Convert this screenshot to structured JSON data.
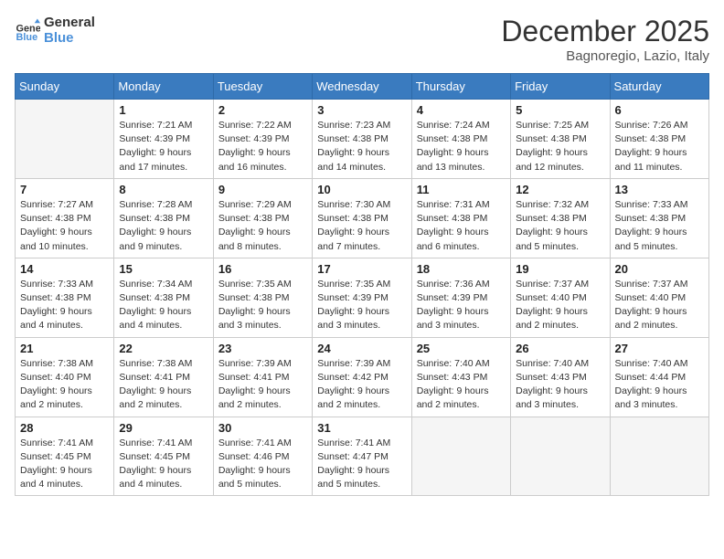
{
  "header": {
    "logo_line1": "General",
    "logo_line2": "Blue",
    "month_title": "December 2025",
    "location": "Bagnoregio, Lazio, Italy"
  },
  "days_of_week": [
    "Sunday",
    "Monday",
    "Tuesday",
    "Wednesday",
    "Thursday",
    "Friday",
    "Saturday"
  ],
  "weeks": [
    [
      {
        "day": "",
        "info": ""
      },
      {
        "day": "1",
        "info": "Sunrise: 7:21 AM\nSunset: 4:39 PM\nDaylight: 9 hours\nand 17 minutes."
      },
      {
        "day": "2",
        "info": "Sunrise: 7:22 AM\nSunset: 4:39 PM\nDaylight: 9 hours\nand 16 minutes."
      },
      {
        "day": "3",
        "info": "Sunrise: 7:23 AM\nSunset: 4:38 PM\nDaylight: 9 hours\nand 14 minutes."
      },
      {
        "day": "4",
        "info": "Sunrise: 7:24 AM\nSunset: 4:38 PM\nDaylight: 9 hours\nand 13 minutes."
      },
      {
        "day": "5",
        "info": "Sunrise: 7:25 AM\nSunset: 4:38 PM\nDaylight: 9 hours\nand 12 minutes."
      },
      {
        "day": "6",
        "info": "Sunrise: 7:26 AM\nSunset: 4:38 PM\nDaylight: 9 hours\nand 11 minutes."
      }
    ],
    [
      {
        "day": "7",
        "info": "Sunrise: 7:27 AM\nSunset: 4:38 PM\nDaylight: 9 hours\nand 10 minutes."
      },
      {
        "day": "8",
        "info": "Sunrise: 7:28 AM\nSunset: 4:38 PM\nDaylight: 9 hours\nand 9 minutes."
      },
      {
        "day": "9",
        "info": "Sunrise: 7:29 AM\nSunset: 4:38 PM\nDaylight: 9 hours\nand 8 minutes."
      },
      {
        "day": "10",
        "info": "Sunrise: 7:30 AM\nSunset: 4:38 PM\nDaylight: 9 hours\nand 7 minutes."
      },
      {
        "day": "11",
        "info": "Sunrise: 7:31 AM\nSunset: 4:38 PM\nDaylight: 9 hours\nand 6 minutes."
      },
      {
        "day": "12",
        "info": "Sunrise: 7:32 AM\nSunset: 4:38 PM\nDaylight: 9 hours\nand 5 minutes."
      },
      {
        "day": "13",
        "info": "Sunrise: 7:33 AM\nSunset: 4:38 PM\nDaylight: 9 hours\nand 5 minutes."
      }
    ],
    [
      {
        "day": "14",
        "info": "Sunrise: 7:33 AM\nSunset: 4:38 PM\nDaylight: 9 hours\nand 4 minutes."
      },
      {
        "day": "15",
        "info": "Sunrise: 7:34 AM\nSunset: 4:38 PM\nDaylight: 9 hours\nand 4 minutes."
      },
      {
        "day": "16",
        "info": "Sunrise: 7:35 AM\nSunset: 4:38 PM\nDaylight: 9 hours\nand 3 minutes."
      },
      {
        "day": "17",
        "info": "Sunrise: 7:35 AM\nSunset: 4:39 PM\nDaylight: 9 hours\nand 3 minutes."
      },
      {
        "day": "18",
        "info": "Sunrise: 7:36 AM\nSunset: 4:39 PM\nDaylight: 9 hours\nand 3 minutes."
      },
      {
        "day": "19",
        "info": "Sunrise: 7:37 AM\nSunset: 4:40 PM\nDaylight: 9 hours\nand 2 minutes."
      },
      {
        "day": "20",
        "info": "Sunrise: 7:37 AM\nSunset: 4:40 PM\nDaylight: 9 hours\nand 2 minutes."
      }
    ],
    [
      {
        "day": "21",
        "info": "Sunrise: 7:38 AM\nSunset: 4:40 PM\nDaylight: 9 hours\nand 2 minutes."
      },
      {
        "day": "22",
        "info": "Sunrise: 7:38 AM\nSunset: 4:41 PM\nDaylight: 9 hours\nand 2 minutes."
      },
      {
        "day": "23",
        "info": "Sunrise: 7:39 AM\nSunset: 4:41 PM\nDaylight: 9 hours\nand 2 minutes."
      },
      {
        "day": "24",
        "info": "Sunrise: 7:39 AM\nSunset: 4:42 PM\nDaylight: 9 hours\nand 2 minutes."
      },
      {
        "day": "25",
        "info": "Sunrise: 7:40 AM\nSunset: 4:43 PM\nDaylight: 9 hours\nand 2 minutes."
      },
      {
        "day": "26",
        "info": "Sunrise: 7:40 AM\nSunset: 4:43 PM\nDaylight: 9 hours\nand 3 minutes."
      },
      {
        "day": "27",
        "info": "Sunrise: 7:40 AM\nSunset: 4:44 PM\nDaylight: 9 hours\nand 3 minutes."
      }
    ],
    [
      {
        "day": "28",
        "info": "Sunrise: 7:41 AM\nSunset: 4:45 PM\nDaylight: 9 hours\nand 4 minutes."
      },
      {
        "day": "29",
        "info": "Sunrise: 7:41 AM\nSunset: 4:45 PM\nDaylight: 9 hours\nand 4 minutes."
      },
      {
        "day": "30",
        "info": "Sunrise: 7:41 AM\nSunset: 4:46 PM\nDaylight: 9 hours\nand 5 minutes."
      },
      {
        "day": "31",
        "info": "Sunrise: 7:41 AM\nSunset: 4:47 PM\nDaylight: 9 hours\nand 5 minutes."
      },
      {
        "day": "",
        "info": ""
      },
      {
        "day": "",
        "info": ""
      },
      {
        "day": "",
        "info": ""
      }
    ]
  ]
}
